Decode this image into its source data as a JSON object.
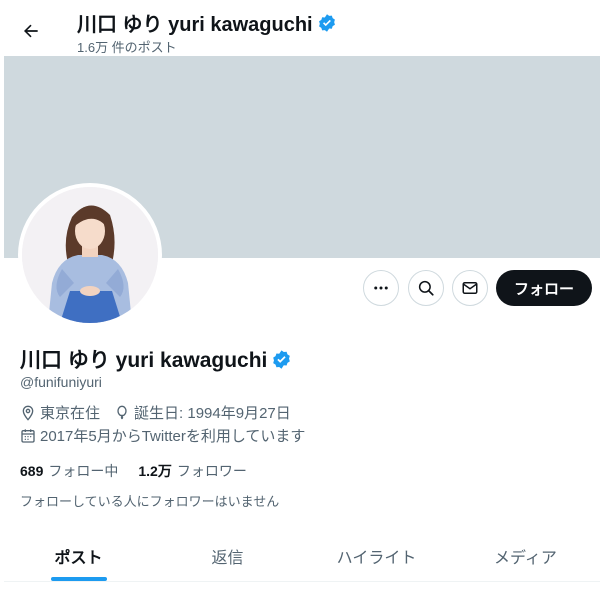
{
  "header": {
    "back_icon": "arrow-left-icon",
    "title": "川口 ゆり yuri kawaguchi",
    "post_count": "1.6万 件のポスト",
    "verified_icon": "verified-badge-icon"
  },
  "profile": {
    "name": "川口 ゆり yuri kawaguchi",
    "handle": "@funifuniyuri",
    "location": "東京在住",
    "birthday": "誕生日: 1994年9月27日",
    "joined": "2017年5月からTwitterを利用しています",
    "following_count": "689",
    "following_label": "フォロー中",
    "followers_count": "1.2万",
    "followers_label": "フォロワー",
    "followers_you_know": "フォローしている人にフォロワーはいません"
  },
  "actions": {
    "more_icon": "more-icon",
    "search_icon": "search-icon",
    "message_icon": "mail-icon",
    "follow_label": "フォロー"
  },
  "tabs": [
    {
      "label": "ポスト",
      "active": true
    },
    {
      "label": "返信",
      "active": false
    },
    {
      "label": "ハイライト",
      "active": false
    },
    {
      "label": "メディア",
      "active": false
    }
  ],
  "colors": {
    "accent": "#1d9bf0",
    "banner": "#cfd9de",
    "text": "#0f1419",
    "muted": "#536471"
  }
}
